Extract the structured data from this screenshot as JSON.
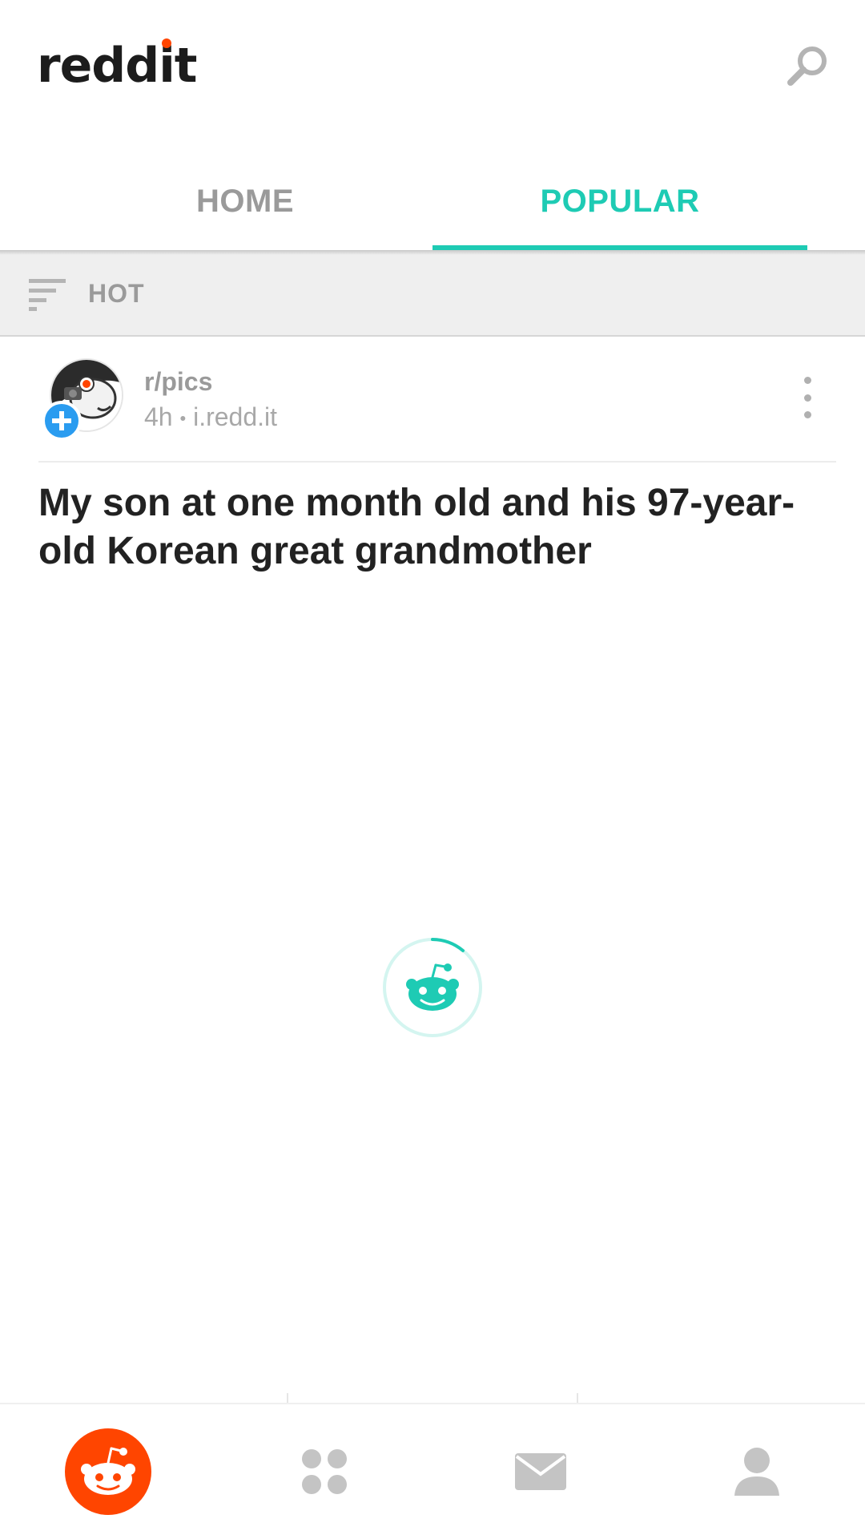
{
  "header": {
    "logo_prefix": "redd",
    "logo_dot_char": "i",
    "logo_suffix": "t",
    "search_icon": "search-icon"
  },
  "tabs": [
    {
      "label": "HOME",
      "active": false
    },
    {
      "label": "POPULAR",
      "active": true
    }
  ],
  "sort": {
    "icon": "sort-icon",
    "label": "HOT"
  },
  "post": {
    "subreddit": "r/pics",
    "age": "4h",
    "separator": "•",
    "domain": "i.redd.it",
    "title": "My son at one month old and his 97-year-old Korean great grandmother"
  },
  "loading": {
    "icon": "snoo-loading-icon"
  },
  "bottom_nav": [
    {
      "name": "home",
      "icon": "snoo-icon",
      "active": true
    },
    {
      "name": "communities",
      "icon": "communities-icon",
      "active": false
    },
    {
      "name": "inbox",
      "icon": "mail-icon",
      "active": false
    },
    {
      "name": "account",
      "icon": "profile-icon",
      "active": false
    }
  ],
  "colors": {
    "accent": "#1ecbb4",
    "brand": "#ff4500",
    "join_badge": "#2a9cf0",
    "inactive": "#9a9a9a"
  }
}
